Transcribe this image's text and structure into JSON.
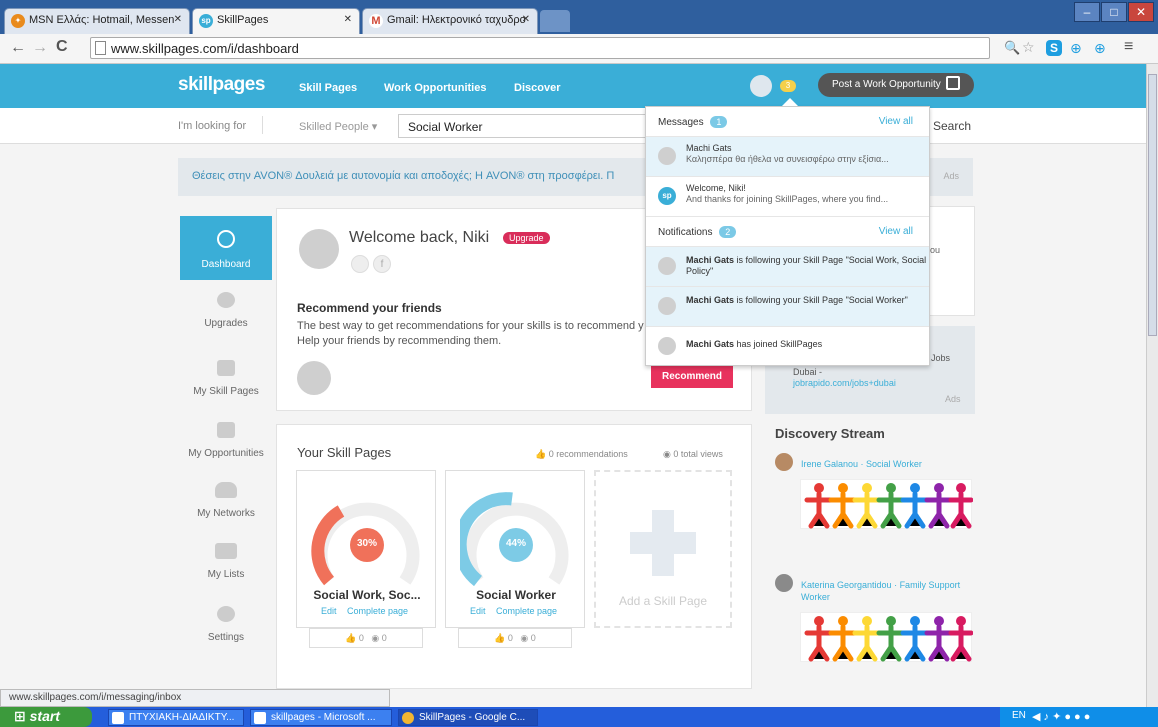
{
  "browser": {
    "tabs": [
      {
        "label": "MSN Ελλάς: Hotmail, Messen",
        "favicon": "msn-icon"
      },
      {
        "label": "SkillPages",
        "favicon": "sp"
      },
      {
        "label": "Gmail: Ηλεκτρονικό ταχυδρο",
        "favicon": "gmail-icon"
      }
    ],
    "url": "www.skillpages.com/i/dashboard",
    "status_url": "www.skillpages.com/i/messaging/inbox"
  },
  "header": {
    "logo": "skillpages",
    "nav": [
      "Skill Pages",
      "Work Opportunities",
      "Discover"
    ],
    "notif_count": "3",
    "post_button": "Post a Work Opportunity"
  },
  "search": {
    "looking_for": "I'm looking for",
    "category": "Skilled People",
    "query": "Social Worker",
    "button": "Search"
  },
  "ad_bar": {
    "text": "Θέσεις στην AVON® Δουλειά με αυτονομία και αποδοχές; Η AVON® στη προσφέρει. Π",
    "ads_label": "Ads"
  },
  "sidebar": [
    {
      "label": "Dashboard",
      "icon": "dashboard-icon",
      "active": true
    },
    {
      "label": "Upgrades",
      "icon": "upgrades-icon"
    },
    {
      "label": "My Skill Pages",
      "icon": "skill-pages-icon"
    },
    {
      "label": "My Opportunities",
      "icon": "opportunities-icon"
    },
    {
      "label": "My Networks",
      "icon": "networks-icon"
    },
    {
      "label": "My Lists",
      "icon": "lists-icon"
    },
    {
      "label": "Settings",
      "icon": "gear-icon"
    }
  ],
  "welcome": {
    "title": "Welcome back, Niki",
    "upgrade": "Upgrade",
    "recommend_title": "Recommend your friends",
    "recommend_text1": "The best way to get recommendations for your skills is to recommend y",
    "recommend_text2": "Help your friends by recommending them.",
    "recommend_button": "Recommend"
  },
  "skill_pages": {
    "title": "Your Skill Pages",
    "recommendations": "0 recommendations",
    "views": "0 total views",
    "items": [
      {
        "name": "Social Work, Soc...",
        "percent": "30%",
        "percent_value": 30,
        "edit": "Edit",
        "complete": "Complete page",
        "likes": "0",
        "views": "0",
        "color": "#f0715a"
      },
      {
        "name": "Social Worker",
        "percent": "44%",
        "percent_value": 44,
        "edit": "Edit",
        "complete": "Complete page",
        "likes": "0",
        "views": "0",
        "color": "#7dcbe6"
      }
    ],
    "add_label": "Add a Skill Page"
  },
  "dropdown": {
    "messages_label": "Messages",
    "messages_count": "1",
    "view_all": "View all",
    "messages": [
      {
        "name": "Machi Gats",
        "text": "Καλησπέρα θα ήθελα να συνεισφέρω στην εξίσια..."
      },
      {
        "name": "Welcome, Niki!",
        "text": "And thanks for joining SkillPages, where you find..."
      }
    ],
    "notifications_label": "Notifications",
    "notifications_count": "2",
    "notifications": [
      {
        "name": "Machi Gats",
        "text": "is following your Skill Page \"Social Work, Social Policy\""
      },
      {
        "name": "Machi Gats",
        "text": "is following your Skill Page \"Social Worker\""
      },
      {
        "name": "Machi Gats",
        "text": "has joined SkillPages"
      }
    ]
  },
  "right": {
    "ad_fragment": "ou",
    "jobs_fragment": "Jobs",
    "dubai": "Dubai -",
    "dubai_link": "jobrapido.com/jobs+dubai",
    "ads": "Ads",
    "discovery_title": "Discovery Stream",
    "stream": [
      {
        "name": "Irene Galanou",
        "role": "Social Worker"
      },
      {
        "name": "Katerina Georgantidou",
        "role": "Family Support Worker"
      }
    ]
  },
  "taskbar": {
    "start": "start",
    "items": [
      "ΠΤΥΧΙΑΚΗ-ΔΙΑΔΙΚΤΥ...",
      "skillpages - Microsoft ...",
      "SkillPages - Google C..."
    ],
    "lang": "EN"
  }
}
